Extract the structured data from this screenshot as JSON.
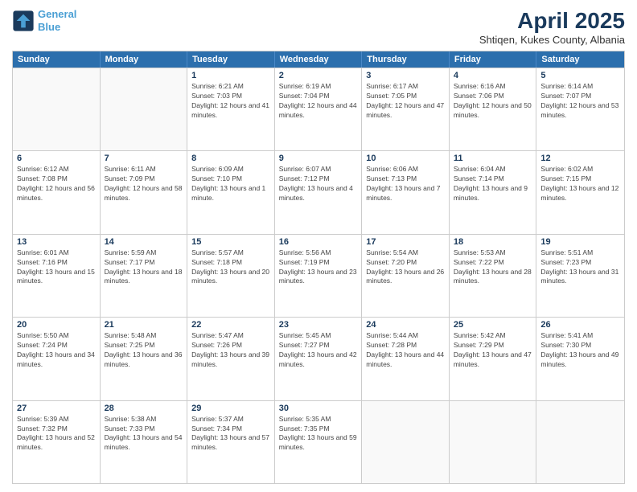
{
  "logo": {
    "line1": "General",
    "line2": "Blue"
  },
  "title": "April 2025",
  "subtitle": "Shtiqen, Kukes County, Albania",
  "days_of_week": [
    "Sunday",
    "Monday",
    "Tuesday",
    "Wednesday",
    "Thursday",
    "Friday",
    "Saturday"
  ],
  "weeks": [
    [
      {
        "day": "",
        "info": ""
      },
      {
        "day": "",
        "info": ""
      },
      {
        "day": "1",
        "info": "Sunrise: 6:21 AM\nSunset: 7:03 PM\nDaylight: 12 hours and 41 minutes."
      },
      {
        "day": "2",
        "info": "Sunrise: 6:19 AM\nSunset: 7:04 PM\nDaylight: 12 hours and 44 minutes."
      },
      {
        "day": "3",
        "info": "Sunrise: 6:17 AM\nSunset: 7:05 PM\nDaylight: 12 hours and 47 minutes."
      },
      {
        "day": "4",
        "info": "Sunrise: 6:16 AM\nSunset: 7:06 PM\nDaylight: 12 hours and 50 minutes."
      },
      {
        "day": "5",
        "info": "Sunrise: 6:14 AM\nSunset: 7:07 PM\nDaylight: 12 hours and 53 minutes."
      }
    ],
    [
      {
        "day": "6",
        "info": "Sunrise: 6:12 AM\nSunset: 7:08 PM\nDaylight: 12 hours and 56 minutes."
      },
      {
        "day": "7",
        "info": "Sunrise: 6:11 AM\nSunset: 7:09 PM\nDaylight: 12 hours and 58 minutes."
      },
      {
        "day": "8",
        "info": "Sunrise: 6:09 AM\nSunset: 7:10 PM\nDaylight: 13 hours and 1 minute."
      },
      {
        "day": "9",
        "info": "Sunrise: 6:07 AM\nSunset: 7:12 PM\nDaylight: 13 hours and 4 minutes."
      },
      {
        "day": "10",
        "info": "Sunrise: 6:06 AM\nSunset: 7:13 PM\nDaylight: 13 hours and 7 minutes."
      },
      {
        "day": "11",
        "info": "Sunrise: 6:04 AM\nSunset: 7:14 PM\nDaylight: 13 hours and 9 minutes."
      },
      {
        "day": "12",
        "info": "Sunrise: 6:02 AM\nSunset: 7:15 PM\nDaylight: 13 hours and 12 minutes."
      }
    ],
    [
      {
        "day": "13",
        "info": "Sunrise: 6:01 AM\nSunset: 7:16 PM\nDaylight: 13 hours and 15 minutes."
      },
      {
        "day": "14",
        "info": "Sunrise: 5:59 AM\nSunset: 7:17 PM\nDaylight: 13 hours and 18 minutes."
      },
      {
        "day": "15",
        "info": "Sunrise: 5:57 AM\nSunset: 7:18 PM\nDaylight: 13 hours and 20 minutes."
      },
      {
        "day": "16",
        "info": "Sunrise: 5:56 AM\nSunset: 7:19 PM\nDaylight: 13 hours and 23 minutes."
      },
      {
        "day": "17",
        "info": "Sunrise: 5:54 AM\nSunset: 7:20 PM\nDaylight: 13 hours and 26 minutes."
      },
      {
        "day": "18",
        "info": "Sunrise: 5:53 AM\nSunset: 7:22 PM\nDaylight: 13 hours and 28 minutes."
      },
      {
        "day": "19",
        "info": "Sunrise: 5:51 AM\nSunset: 7:23 PM\nDaylight: 13 hours and 31 minutes."
      }
    ],
    [
      {
        "day": "20",
        "info": "Sunrise: 5:50 AM\nSunset: 7:24 PM\nDaylight: 13 hours and 34 minutes."
      },
      {
        "day": "21",
        "info": "Sunrise: 5:48 AM\nSunset: 7:25 PM\nDaylight: 13 hours and 36 minutes."
      },
      {
        "day": "22",
        "info": "Sunrise: 5:47 AM\nSunset: 7:26 PM\nDaylight: 13 hours and 39 minutes."
      },
      {
        "day": "23",
        "info": "Sunrise: 5:45 AM\nSunset: 7:27 PM\nDaylight: 13 hours and 42 minutes."
      },
      {
        "day": "24",
        "info": "Sunrise: 5:44 AM\nSunset: 7:28 PM\nDaylight: 13 hours and 44 minutes."
      },
      {
        "day": "25",
        "info": "Sunrise: 5:42 AM\nSunset: 7:29 PM\nDaylight: 13 hours and 47 minutes."
      },
      {
        "day": "26",
        "info": "Sunrise: 5:41 AM\nSunset: 7:30 PM\nDaylight: 13 hours and 49 minutes."
      }
    ],
    [
      {
        "day": "27",
        "info": "Sunrise: 5:39 AM\nSunset: 7:32 PM\nDaylight: 13 hours and 52 minutes."
      },
      {
        "day": "28",
        "info": "Sunrise: 5:38 AM\nSunset: 7:33 PM\nDaylight: 13 hours and 54 minutes."
      },
      {
        "day": "29",
        "info": "Sunrise: 5:37 AM\nSunset: 7:34 PM\nDaylight: 13 hours and 57 minutes."
      },
      {
        "day": "30",
        "info": "Sunrise: 5:35 AM\nSunset: 7:35 PM\nDaylight: 13 hours and 59 minutes."
      },
      {
        "day": "",
        "info": ""
      },
      {
        "day": "",
        "info": ""
      },
      {
        "day": "",
        "info": ""
      }
    ]
  ]
}
